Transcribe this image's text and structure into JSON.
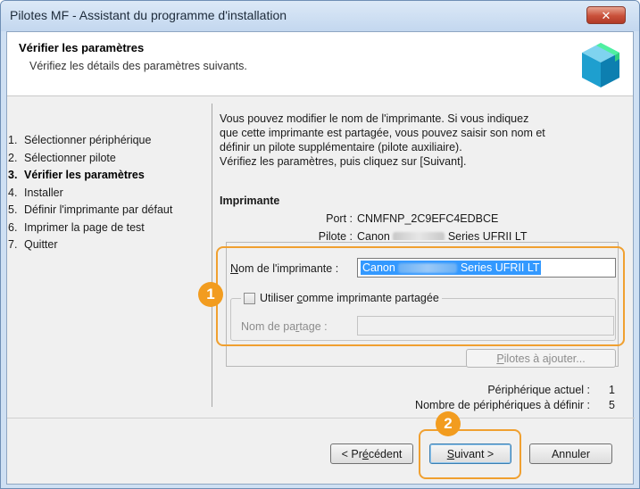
{
  "window": {
    "title": "Pilotes MF - Assistant du programme d'installation",
    "close_symbol": "✕"
  },
  "header": {
    "title": "Vérifier les paramètres",
    "subtitle": "Vérifiez les détails des paramètres suivants.",
    "icon": "install-box-icon"
  },
  "steps": [
    {
      "num": "1.",
      "label": "Sélectionner périphérique",
      "active": false
    },
    {
      "num": "2.",
      "label": "Sélectionner pilote",
      "active": false
    },
    {
      "num": "3.",
      "label": "Vérifier les paramètres",
      "active": true
    },
    {
      "num": "4.",
      "label": "Installer",
      "active": false
    },
    {
      "num": "5.",
      "label": "Définir l'imprimante par défaut",
      "active": false
    },
    {
      "num": "6.",
      "label": "Imprimer la page de test",
      "active": false
    },
    {
      "num": "7.",
      "label": "Quitter",
      "active": false
    }
  ],
  "content": {
    "description_lines": [
      "Vous pouvez modifier le nom de l'imprimante. Si vous indiquez",
      "que cette imprimante est partagée, vous pouvez saisir son nom et",
      "définir un pilote supplémentaire (pilote auxiliaire).",
      "Vérifiez les paramètres, puis cliquez sur [Suivant]."
    ],
    "section_title": "Imprimante",
    "port_label": "Port :",
    "port_value": "CNMFNP_2C9EFC4EDBCE",
    "driver_label": "Pilote :",
    "driver_value_prefix": "Canon",
    "driver_value_suffix": "Series UFRII LT"
  },
  "form": {
    "printer_name_label_first": "N",
    "printer_name_label_rest": "om de l'imprimante :",
    "printer_name_prefix": "Canon",
    "printer_name_suffix": "Series UFRII LT",
    "share_checkbox_first": "Utiliser ",
    "share_checkbox_underline": "c",
    "share_checkbox_rest": "omme imprimante partagée",
    "share_checked": false,
    "share_name_label_first": "Nom de pa",
    "share_name_label_underline": "r",
    "share_name_label_rest": "tage :",
    "share_name_value": "",
    "add_drivers_underline": "P",
    "add_drivers_rest": "ilotes à ajouter..."
  },
  "counters": {
    "current_label": "Périphérique actuel :",
    "current_value": "1",
    "total_label": "Nombre de périphériques à définir :",
    "total_value": "5"
  },
  "buttons": {
    "back_first": "< Pr",
    "back_underline": "é",
    "back_rest": "cédent",
    "next_underline": "S",
    "next_rest": "uivant >",
    "cancel": "Annuler"
  },
  "callouts": {
    "one": "1",
    "two": "2",
    "color": "#f29c1f"
  }
}
